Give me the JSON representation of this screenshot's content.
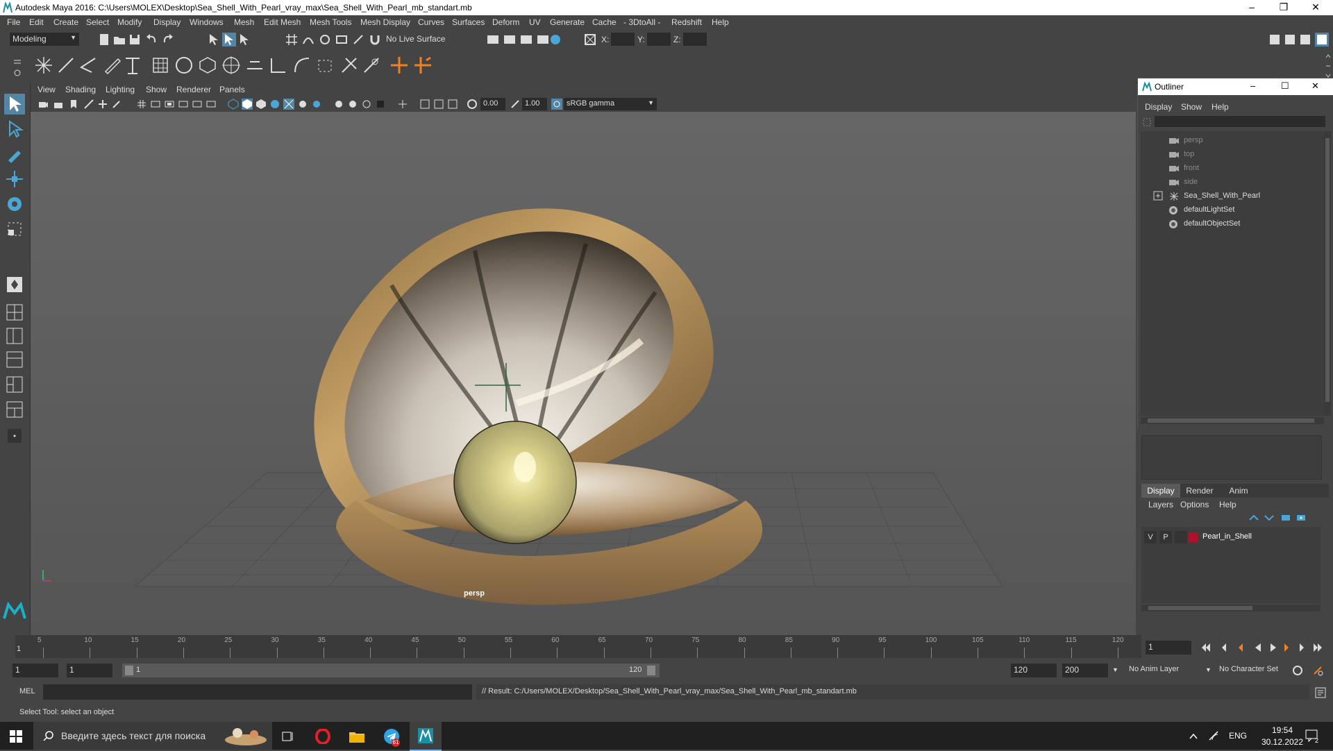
{
  "title_bar": {
    "title": "Autodesk Maya 2016: C:\\Users\\MOLEX\\Desktop\\Sea_Shell_With_Pearl_vray_max\\Sea_Shell_With_Pearl_mb_standart.mb",
    "minimize": "–",
    "restore": "❐",
    "close": "✕"
  },
  "menu": [
    "File",
    "Edit",
    "Create",
    "Select",
    "Modify",
    "Display",
    "Windows",
    "Mesh",
    "Edit Mesh",
    "Mesh Tools",
    "Mesh Display",
    "Curves",
    "Surfaces",
    "Deform",
    "UV",
    "Generate",
    "Cache",
    "- 3DtoAll -",
    "Redshift",
    "Help"
  ],
  "status_line": {
    "mode": "Modeling",
    "live_surface": "No Live Surface",
    "x_label": "X:",
    "y_label": "Y:",
    "z_label": "Z:"
  },
  "viewport": {
    "menu": [
      "View",
      "Shading",
      "Lighting",
      "Show",
      "Renderer",
      "Panels"
    ],
    "exposure": "0.00",
    "gamma": "1.00",
    "color_space": "sRGB gamma",
    "camera_label": "persp"
  },
  "outliner": {
    "title": "Outliner",
    "menu": [
      "Display",
      "Show",
      "Help"
    ],
    "items": [
      {
        "label": "persp",
        "kind": "camera",
        "dim": true
      },
      {
        "label": "top",
        "kind": "camera",
        "dim": true
      },
      {
        "label": "front",
        "kind": "camera",
        "dim": true
      },
      {
        "label": "side",
        "kind": "camera",
        "dim": true
      },
      {
        "label": "Sea_Shell_With_Pearl",
        "kind": "group",
        "dim": false,
        "expandable": true
      },
      {
        "label": "defaultLightSet",
        "kind": "set",
        "dim": false
      },
      {
        "label": "defaultObjectSet",
        "kind": "set",
        "dim": false
      }
    ]
  },
  "layer_editor": {
    "tabs": [
      "Display",
      "Render",
      "Anim"
    ],
    "active_tab": "Display",
    "menu": [
      "Layers",
      "Options",
      "Help"
    ],
    "layers": [
      {
        "visible": "V",
        "playback": "P",
        "name": "Pearl_in_Shell",
        "color": "#b0102a"
      }
    ]
  },
  "timeline": {
    "ticks": [
      "5",
      "10",
      "15",
      "20",
      "25",
      "30",
      "35",
      "40",
      "45",
      "50",
      "55",
      "60",
      "65",
      "70",
      "75",
      "80",
      "85",
      "90",
      "95",
      "100",
      "105",
      "110",
      "115",
      "120"
    ],
    "current_marker": "1",
    "current_frame": "1"
  },
  "range": {
    "start": "1",
    "playback_start": "1",
    "slider_start": "1",
    "slider_end": "120",
    "playback_end": "120",
    "end": "200",
    "anim_layer": "No Anim Layer",
    "character_set": "No Character Set"
  },
  "command_line": {
    "language": "MEL",
    "result": "// Result: C:/Users/MOLEX/Desktop/Sea_Shell_With_Pearl_vray_max/Sea_Shell_With_Pearl_mb_standart.mb"
  },
  "help_line": "Select Tool: select an object",
  "taskbar": {
    "search_placeholder": "Введите здесь текст для поиска",
    "language": "ENG",
    "time": "19:54",
    "date": "30.12.2022",
    "telegram_badge": "61",
    "notif_badge": "2"
  },
  "colors": {
    "ui_bg": "#444444",
    "viewport_bg": "#5c5c5c",
    "accent": "#5285a6",
    "layer_color": "#b0102a"
  }
}
